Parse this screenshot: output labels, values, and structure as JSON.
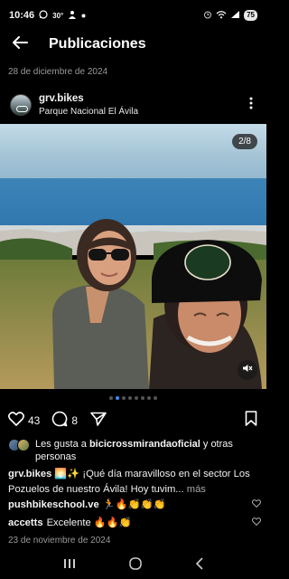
{
  "status_bar": {
    "time": "10:46",
    "temperature": "30°",
    "battery": "75",
    "icons": [
      "whatsapp-icon",
      "person-icon",
      "dot-icon",
      "alarm-icon",
      "wifi-icon",
      "signal-icon"
    ]
  },
  "header": {
    "title": "Publicaciones",
    "back_icon": "arrow-left-icon"
  },
  "post": {
    "date_top": "28 de diciembre de 2024",
    "username": "grv.bikes",
    "location": "Parque Nacional El Ávila",
    "slide_counter": "2/8",
    "slide_index": 2,
    "slide_total": 8,
    "like_count": "43",
    "comment_count": "8",
    "likes_prefix": "Les gusta a ",
    "likes_user": "bicicrossmirandaoficial",
    "likes_suffix": " y otras personas",
    "caption_user": "grv.bikes",
    "caption_text": " 🌅✨ ¡Qué día maravilloso en el sector Los Pozuelos de nuestro Ávila! Hoy tuvim...",
    "more_label": " más",
    "comments": [
      {
        "user": "pushbikeschool.ve",
        "text": "🏃🔥👏👏👏"
      },
      {
        "user": "accetts",
        "text": "Excelente 🔥🔥👏"
      }
    ],
    "date_bottom": "23 de noviembre de 2024",
    "colors": {
      "accent_dot": "#3b8ef5",
      "background": "#000000",
      "muted_text": "#9a9a9a"
    }
  }
}
